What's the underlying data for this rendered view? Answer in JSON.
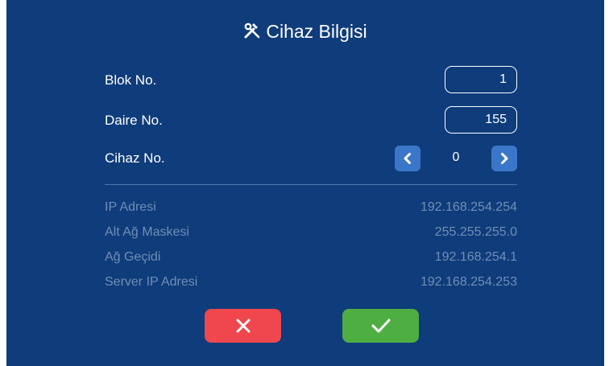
{
  "dialog": {
    "title": "Cihaz Bilgisi",
    "title_icon": "tools-icon"
  },
  "fields": [
    {
      "label": "Blok No.",
      "value": "1"
    },
    {
      "label": "Daire No.",
      "value": "155"
    }
  ],
  "device": {
    "label": "Cihaz No.",
    "value": "0",
    "decrement_icon": "chevron-left-icon",
    "increment_icon": "chevron-right-icon"
  },
  "network": [
    {
      "label": "IP Adresi",
      "value": "192.168.254.254"
    },
    {
      "label": "Alt Ağ Maskesi",
      "value": "255.255.255.0"
    },
    {
      "label": "Ağ Geçidi",
      "value": "192.168.254.1"
    },
    {
      "label": "Server IP Adresi",
      "value": "192.168.254.253"
    }
  ],
  "actions": {
    "cancel_icon": "close-icon",
    "confirm_icon": "check-icon"
  },
  "colors": {
    "background": "#0f3c7a",
    "stepper_button": "#3a77c8",
    "muted_text": "#6f8fb6",
    "cancel": "#f0474f",
    "confirm": "#4fae42"
  }
}
